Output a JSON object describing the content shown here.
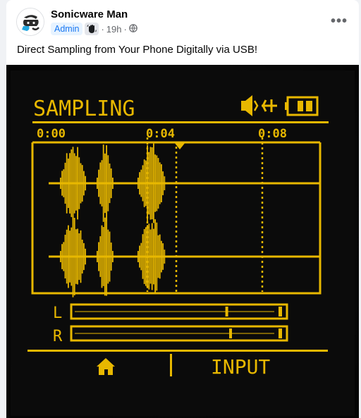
{
  "post": {
    "author": "Sonicware Man",
    "role_badge": "Admin",
    "badge_icon": "hand-wave-icon",
    "time": "19h",
    "separator": "·",
    "audience_icon": "globe-icon",
    "more_label": "•••",
    "caption": "Direct Sampling from Your Phone Digitally via USB!"
  },
  "device_screen": {
    "title": "SAMPLING",
    "time_marks": [
      "0:00",
      "0:04",
      "0:08"
    ],
    "channel_left": "L",
    "channel_right": "R",
    "left_level": 0.78,
    "right_level": 0.8,
    "home_icon": "home-icon",
    "input_label": "INPUT",
    "status_icons": [
      "speaker-icon",
      "usb-icon",
      "battery-icon"
    ],
    "display_color": "#e8b800"
  }
}
